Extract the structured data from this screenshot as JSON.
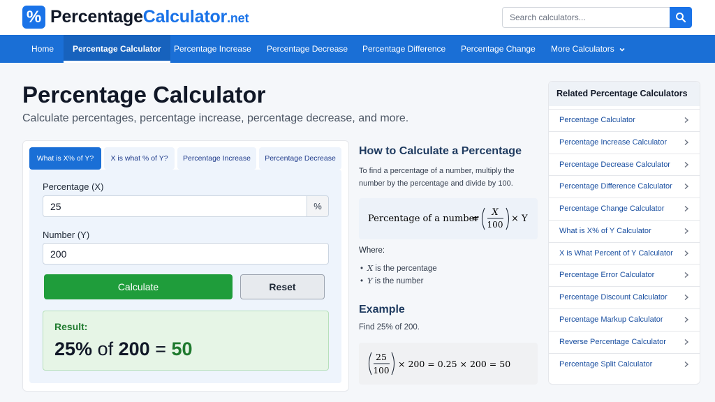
{
  "header": {
    "logo_symbol": "%",
    "logo_main": "Percentage",
    "logo_blue": "Calculator",
    "logo_tld": ".net",
    "search_placeholder": "Search calculators...",
    "search_icon": "search-icon"
  },
  "nav": {
    "items": [
      {
        "label": "Home"
      },
      {
        "label": "Percentage Calculator",
        "active": true
      },
      {
        "label": "Percentage Increase"
      },
      {
        "label": "Percentage Decrease"
      },
      {
        "label": "Percentage Difference"
      },
      {
        "label": "Percentage Change"
      },
      {
        "label": "More Calculators"
      }
    ]
  },
  "main": {
    "title": "Percentage Calculator",
    "subtitle": "Calculate percentages, percentage increase, percentage decrease, and more."
  },
  "calculator": {
    "tabs": [
      {
        "label": "What is X% of Y?",
        "active": true
      },
      {
        "label": "X is what % of Y?"
      },
      {
        "label": "Percentage Increase"
      },
      {
        "label": "Percentage Decrease"
      }
    ],
    "field_x_label": "Percentage (X)",
    "field_x_value": "25",
    "field_x_unit": "%",
    "field_y_label": "Number (Y)",
    "field_y_value": "200",
    "calculate_label": "Calculate",
    "reset_label": "Reset",
    "result_label": "Result:",
    "result_pct": "25%",
    "result_of": "of",
    "result_num": "200",
    "result_eq": "=",
    "result_value": "50"
  },
  "howto": {
    "title": "How to Calculate a Percentage",
    "text": "To find a percentage of a number, multiply the number by the percentage and divide by 100.",
    "formula_lhs": "Percentage of a number",
    "formula_num": "X",
    "formula_den": "100",
    "formula_times": "× Y",
    "where_label": "Where:",
    "bullets": [
      {
        "var": "X",
        "text": "is the percentage"
      },
      {
        "var": "Y",
        "text": "is the number"
      }
    ],
    "example_title": "Example",
    "example_text": "Find 25% of 200.",
    "example_num": "25",
    "example_den": "100",
    "example_rest": "× 200 = 0.25 × 200 = 50"
  },
  "sidebar": {
    "title": "Related Percentage Calculators",
    "items": [
      {
        "label": "Percentage Calculator"
      },
      {
        "label": "Percentage Increase Calculator"
      },
      {
        "label": "Percentage Decrease Calculator"
      },
      {
        "label": "Percentage Difference Calculator"
      },
      {
        "label": "Percentage Change Calculator"
      },
      {
        "label": "What is X% of Y Calculator"
      },
      {
        "label": "X is What Percent of Y Calculator"
      },
      {
        "label": "Percentage Error Calculator"
      },
      {
        "label": "Percentage Discount Calculator"
      },
      {
        "label": "Percentage Markup Calculator"
      },
      {
        "label": "Reverse Percentage Calculator"
      },
      {
        "label": "Percentage Split Calculator"
      }
    ]
  },
  "colors": {
    "primary": "#1a73e8",
    "nav_bg": "#1a6fd6",
    "calculate_green": "#1f9d3b",
    "result_green": "#1f7a2e"
  }
}
